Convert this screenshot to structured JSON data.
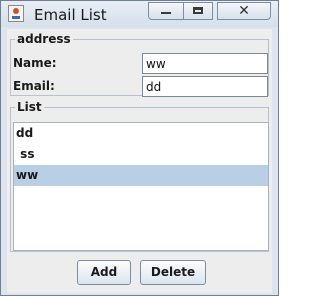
{
  "window": {
    "title": "Email List",
    "icon": "java-cup-icon",
    "controls": {
      "minimize": "minimize-icon",
      "maximize": "maximize-icon",
      "close_label": "✕"
    }
  },
  "address": {
    "legend": "address",
    "name_label": "Name:",
    "name_value": "ww",
    "email_label": "Email:",
    "email_value": "dd"
  },
  "list": {
    "legend": "List",
    "items": [
      {
        "label": "dd",
        "selected": false
      },
      {
        "label": " ss",
        "selected": false
      },
      {
        "label": "ww",
        "selected": true
      }
    ]
  },
  "buttons": {
    "add_label": "Add",
    "delete_label": "Delete"
  },
  "colors": {
    "selection": "#b8cfe5",
    "frame": "#dde4ee",
    "panel": "#ededed"
  }
}
